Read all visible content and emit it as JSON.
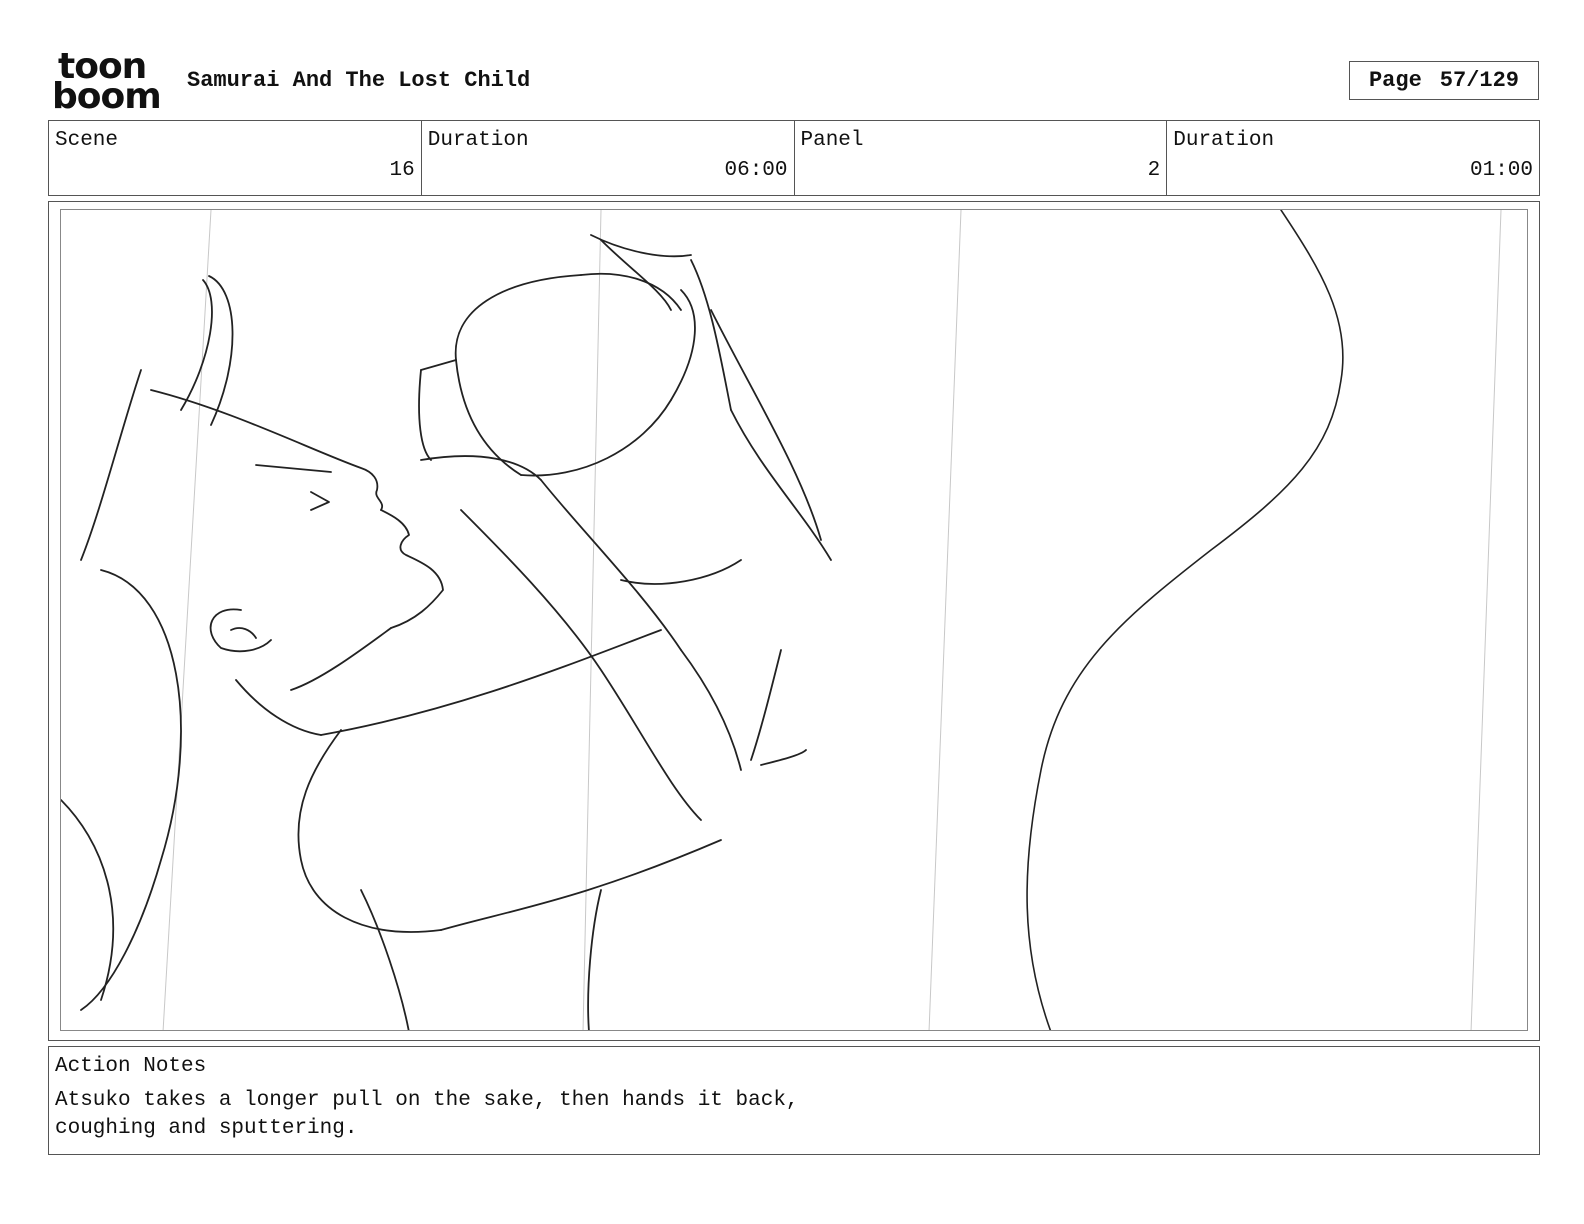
{
  "header": {
    "logo": {
      "line1": "toon",
      "line2": "boom",
      "icon": "toon-boom-logo"
    },
    "title": "Samurai And The Lost Child",
    "page_label": "Page",
    "page_value": "57/129"
  },
  "info": {
    "scene_label": "Scene",
    "scene_value": "16",
    "scene_duration_label": "Duration",
    "scene_duration_value": "06:00",
    "panel_label": "Panel",
    "panel_value": "2",
    "panel_duration_label": "Duration",
    "panel_duration_value": "01:00"
  },
  "panel": {
    "image": "storyboard-sketch"
  },
  "notes": {
    "label": "Action Notes",
    "text": "Atsuko takes a longer pull on the sake, then hands it back,\ncoughing and sputtering."
  }
}
